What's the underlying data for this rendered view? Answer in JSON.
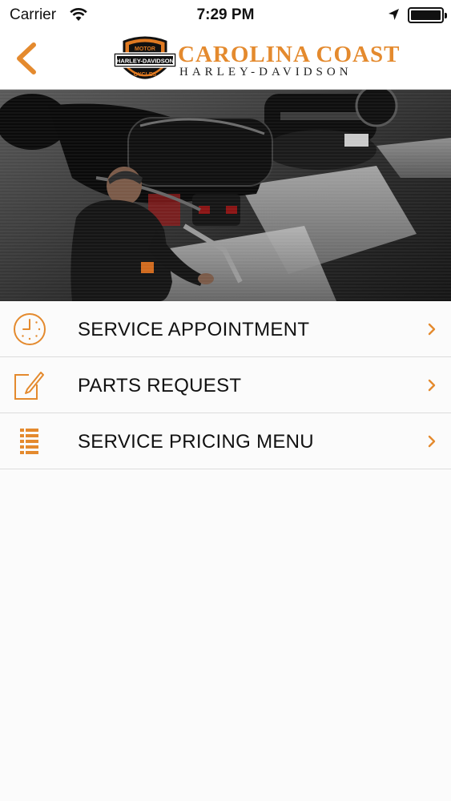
{
  "status_bar": {
    "carrier": "Carrier",
    "time": "7:29 PM"
  },
  "header": {
    "logo_icon": "harley-davidson-bar-and-shield-logo",
    "logo_text": "MOTOR HARLEY-DAVIDSON CYCLES",
    "brand_name": "CAROLINA COAST",
    "brand_subtitle": "HARLEY-DAVIDSON"
  },
  "hero": {
    "image": "mechanic-servicing-motorcycles-photo"
  },
  "menu": {
    "items": [
      {
        "label": "SERVICE APPOINTMENT",
        "icon": "clock-icon"
      },
      {
        "label": "PARTS REQUEST",
        "icon": "edit-icon"
      },
      {
        "label": "SERVICE PRICING MENU",
        "icon": "list-icon"
      }
    ]
  },
  "colors": {
    "accent": "#e48a2e",
    "background": "#fbfbfb",
    "divider": "#dcdcdc"
  }
}
